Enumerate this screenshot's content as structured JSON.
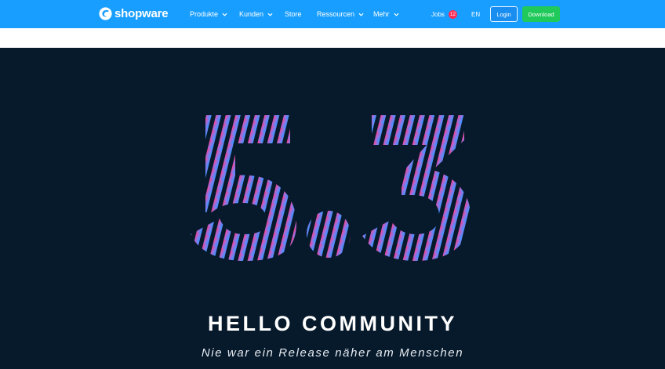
{
  "brand": {
    "name": "shopware",
    "icon": "shopware-logo-icon"
  },
  "nav": {
    "items": [
      {
        "label": "Produkte",
        "dropdown": true
      },
      {
        "label": "Kunden",
        "dropdown": true
      },
      {
        "label": "Store",
        "dropdown": false
      },
      {
        "label": "Ressourcen",
        "dropdown": true
      },
      {
        "label": "Mehr",
        "dropdown": true
      }
    ],
    "jobs_label": "Jobs",
    "jobs_count": "12",
    "language": "EN",
    "login_label": "Login",
    "download_label": "Download"
  },
  "hero": {
    "version_art": "5.3",
    "title": "HELLO COMMUNITY",
    "subtitle": "Nie war ein Release näher am Menschen"
  },
  "colors": {
    "nav_bg": "#189eff",
    "hero_bg": "#061a2c",
    "download_bg": "#1fc95a",
    "badge_bg": "#ff2d55",
    "gradient_start": "#ff3a86",
    "gradient_end": "#4a90ff"
  }
}
